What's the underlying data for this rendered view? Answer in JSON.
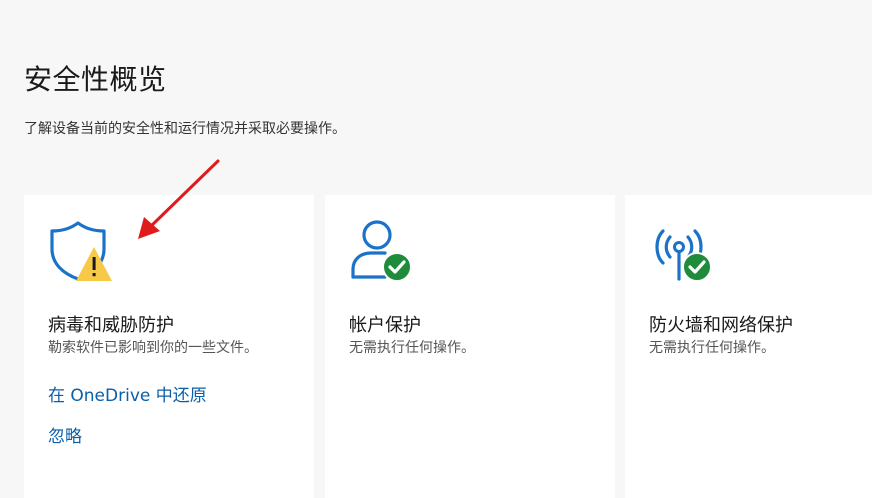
{
  "header": {
    "title": "安全性概览",
    "subtitle": "了解设备当前的安全性和运行情况并采取必要操作。"
  },
  "cards": [
    {
      "title": "病毒和威胁防护",
      "description": "勒索软件已影响到你的一些文件。",
      "icon": "shield-warning-icon",
      "status": "warning",
      "links": [
        "在 OneDrive 中还原",
        "忽略"
      ]
    },
    {
      "title": "帐户保护",
      "description": "无需执行任何操作。",
      "icon": "person-check-icon",
      "status": "ok"
    },
    {
      "title": "防火墙和网络保护",
      "description": "无需执行任何操作。",
      "icon": "antenna-check-icon",
      "status": "ok"
    }
  ],
  "colors": {
    "accent": "#0a5fa8",
    "icon_blue": "#1a73c8",
    "warning_yellow": "#f7c948",
    "ok_green": "#1e8c3a",
    "annotation_red": "#e01b1b"
  }
}
